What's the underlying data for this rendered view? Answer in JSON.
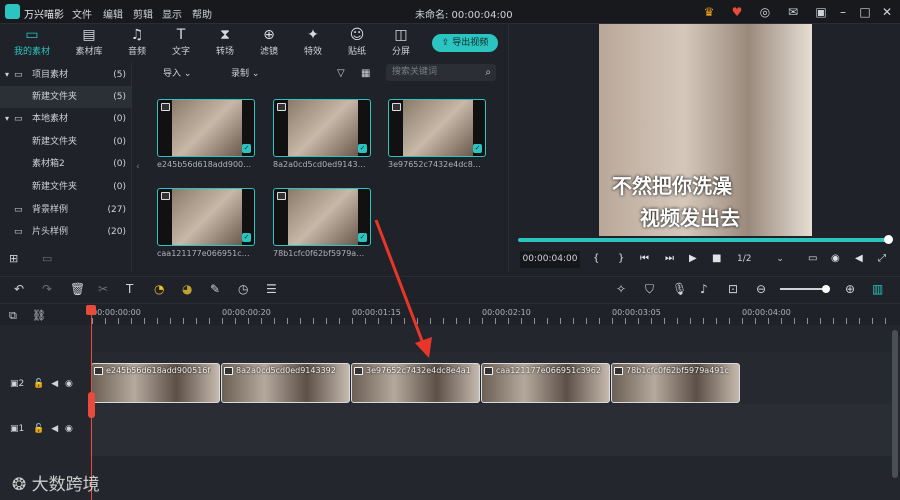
{
  "app": {
    "name": "万兴喵影",
    "document_title": "未命名: 00:00:04:00"
  },
  "menubar": [
    "文件",
    "编辑",
    "剪辑",
    "显示",
    "帮助"
  ],
  "tools": [
    {
      "label": "我的素材",
      "icon": "folder-icon",
      "active": true
    },
    {
      "label": "素材库",
      "icon": "library-icon"
    },
    {
      "label": "音频",
      "icon": "music-icon"
    },
    {
      "label": "文字",
      "icon": "text-icon"
    },
    {
      "label": "转场",
      "icon": "transition-icon"
    },
    {
      "label": "滤镜",
      "icon": "filter-icon"
    },
    {
      "label": "特效",
      "icon": "effects-icon"
    },
    {
      "label": "贴纸",
      "icon": "sticker-icon"
    },
    {
      "label": "分屏",
      "icon": "split-screen-icon"
    }
  ],
  "export_label": "导出视频",
  "sidebar": [
    {
      "label": "项目素材",
      "count": "(5)",
      "expanded": true
    },
    {
      "label": "新建文件夹",
      "count": "(5)",
      "selected": true
    },
    {
      "label": "本地素材",
      "count": "(0)",
      "expanded": true
    },
    {
      "label": "新建文件夹",
      "count": "(0)"
    },
    {
      "label": "素材箱2",
      "count": "(0)"
    },
    {
      "label": "新建文件夹",
      "count": "(0)"
    },
    {
      "label": "背景样例",
      "count": "(27)"
    },
    {
      "label": "片头样例",
      "count": "(20)"
    }
  ],
  "media_toolbar": {
    "import_label": "导入",
    "record_label": "录制",
    "search_placeholder": "搜索关键词"
  },
  "media_items": [
    {
      "name": "e245b56d618add900…"
    },
    {
      "name": "8a2a0cd5cd0ed9143…"
    },
    {
      "name": "3e97652c7432e4dc8…"
    },
    {
      "name": "caa121177e066951c…"
    },
    {
      "name": "78b1cfc0f62bf5979a…"
    }
  ],
  "preview": {
    "caption_line1": "不然把你洗澡",
    "caption_line2": "视频发出去",
    "timecode": "00:00:04:00",
    "zoom": "1/2",
    "progress": 1.0
  },
  "ruler": [
    "00:00:00:00",
    "00:00:00:20",
    "00:00:01:15",
    "00:00:02:10",
    "00:00:03:05",
    "00:00:04:00"
  ],
  "tracks": [
    {
      "label": "2"
    },
    {
      "label": "1"
    }
  ],
  "clips": [
    {
      "name": "e245b56d618add900516f"
    },
    {
      "name": "8a2a0cd5cd0ed9143392"
    },
    {
      "name": "3e97652c7432e4dc8e4a1"
    },
    {
      "name": "caa121177e066951c3962"
    },
    {
      "name": "78b1cfc0f62bf5979a491c"
    }
  ],
  "watermark": "大数跨境",
  "colors": {
    "accent": "#2bc4c0",
    "playhead": "#e84a3c",
    "arrow": "#e8362a"
  }
}
